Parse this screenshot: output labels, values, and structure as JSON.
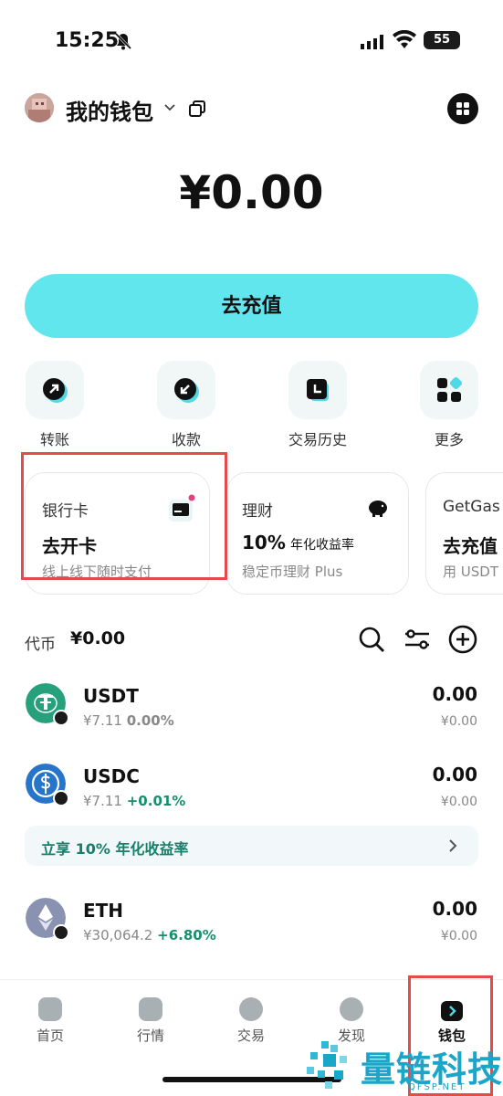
{
  "status_bar": {
    "time": "15:25",
    "battery": "55"
  },
  "header": {
    "wallet_name": "我的钱包"
  },
  "balance": "¥0.00",
  "deposit_button": "去充值",
  "quick_actions": [
    {
      "label": "转账",
      "icon": "arrow-up-right-icon"
    },
    {
      "label": "收款",
      "icon": "arrow-down-left-icon"
    },
    {
      "label": "交易历史",
      "icon": "clock-icon"
    },
    {
      "label": "更多",
      "icon": "grid-icon"
    }
  ],
  "cards": [
    {
      "title": "银行卡",
      "main": "去开卡",
      "sub": "线上线下随时支付"
    },
    {
      "title": "理财",
      "main": "10%",
      "main_suffix": "年化收益率",
      "sub": "稳定币理财 Plus"
    },
    {
      "title": "GetGas",
      "main": "去充值",
      "sub": "用 USDT"
    }
  ],
  "tokens_header": {
    "label": "代币",
    "total": "¥0.00"
  },
  "tokens": [
    {
      "name": "USDT",
      "price": "¥7.11",
      "change": "0.00%",
      "amount": "0.00",
      "fiat": "¥0.00",
      "color": "#26a17b"
    },
    {
      "name": "USDC",
      "price": "¥7.11",
      "change": "+0.01%",
      "amount": "0.00",
      "fiat": "¥0.00",
      "color": "#2775ca"
    },
    {
      "name": "ETH",
      "price": "¥30,064.2",
      "change": "+6.80%",
      "amount": "0.00",
      "fiat": "¥0.00",
      "color": "#8a92b2"
    }
  ],
  "promo": {
    "text": "立享 10% 年化收益率"
  },
  "tabs": [
    {
      "label": "首页"
    },
    {
      "label": "行情"
    },
    {
      "label": "交易"
    },
    {
      "label": "发现"
    },
    {
      "label": "钱包"
    }
  ],
  "watermark": {
    "text": "量链科技",
    "sub": "QFSP.NET"
  }
}
